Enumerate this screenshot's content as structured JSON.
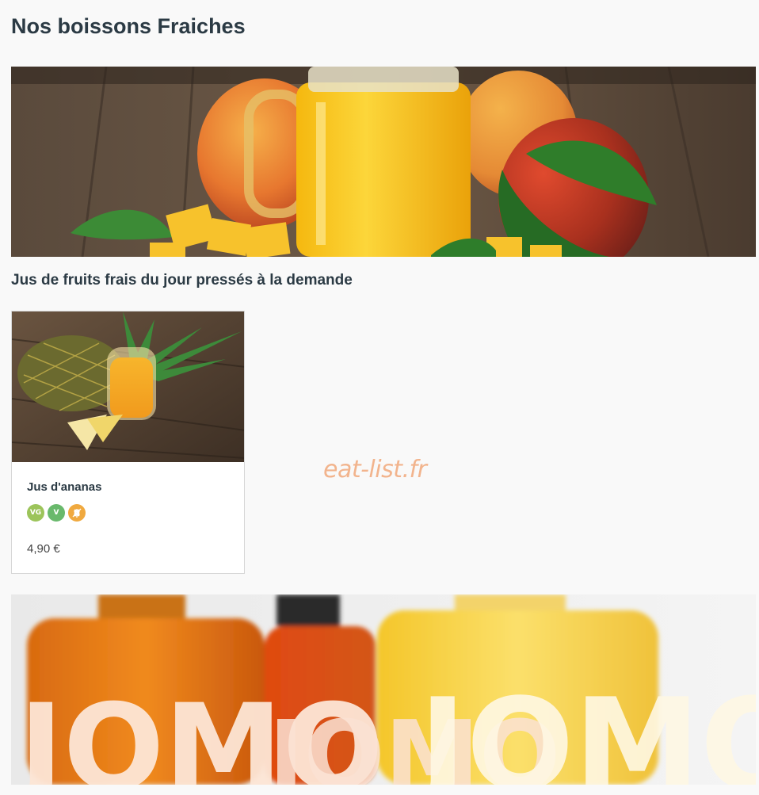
{
  "page": {
    "title": "Nos boissons Fraiches"
  },
  "section": {
    "heading": "Jus de fruits frais du jour pressés à la demande"
  },
  "product": {
    "name": "Jus d'ananas",
    "price": "4,90 €",
    "badges": [
      {
        "label": "VG",
        "icon": "vegan-icon",
        "color": "#9cc45a"
      },
      {
        "label": "V",
        "icon": "vegetarian-icon",
        "color": "#69b96c"
      },
      {
        "label": "",
        "icon": "gluten-free-icon",
        "color": "#f0a93f"
      }
    ]
  },
  "bottom_banner": {
    "brand_text": "JOMO"
  },
  "watermark": "eat-list.fr",
  "colors": {
    "background": "#f9f9f9",
    "title": "#2b3a44",
    "watermark": "#f2b48d"
  }
}
